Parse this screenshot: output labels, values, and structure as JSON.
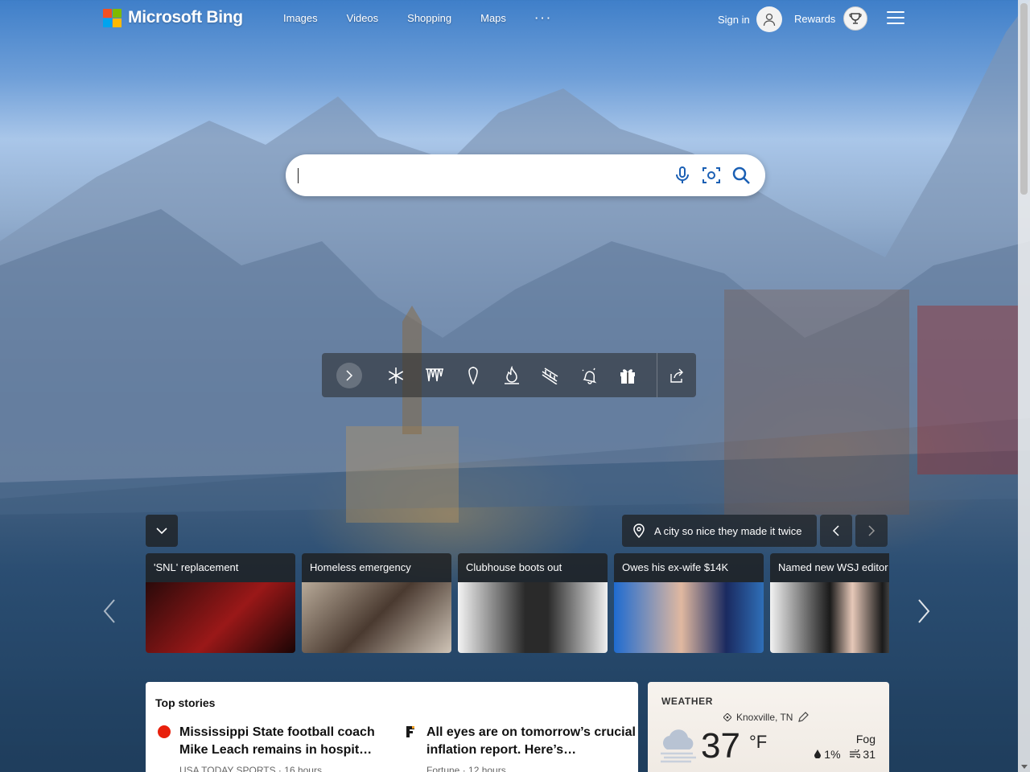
{
  "header": {
    "brand": "Microsoft Bing",
    "nav": [
      "Images",
      "Videos",
      "Shopping",
      "Maps",
      "···"
    ],
    "signin_label": "Sign in",
    "rewards_label": "Rewards"
  },
  "search": {
    "value": "",
    "placeholder": "",
    "icons": [
      "microphone-icon",
      "visual-search-icon",
      "search-icon"
    ]
  },
  "toolbar": {
    "icons": [
      "snowflake-icon",
      "icicles-icon",
      "carrot-icon",
      "fire-icon",
      "sled-icon",
      "bell-icon",
      "gift-icon",
      "share-icon"
    ]
  },
  "image_info": {
    "caption": "A city so nice they made it twice"
  },
  "news_cards": [
    {
      "caption": "'SNL' replacement",
      "pic_color": "#7a1010"
    },
    {
      "caption": "Homeless emergency",
      "pic_color": "#8a7a6a"
    },
    {
      "caption": "Clubhouse boots out",
      "pic_color": "#dcdcdc"
    },
    {
      "caption": "Owes his ex-wife $14K",
      "pic_color": "#2f6fb8"
    },
    {
      "caption": "Named new WSJ editor",
      "pic_color": "#e8e8e8"
    }
  ],
  "top_stories": {
    "title": "Top stories",
    "stories": [
      {
        "headline": "Mississippi State football coach Mike Leach remains in hospit…",
        "meta": "USA TODAY SPORTS · 16 hours",
        "source_color": "#e8200c"
      },
      {
        "headline": "All eyes are on tomorrow’s crucial inflation report. Here’s…",
        "meta": "Fortune · 12 hours",
        "source_color": "#1a1a1a"
      }
    ]
  },
  "weather": {
    "title": "WEATHER",
    "location": "Knoxville, TN",
    "temp": "37",
    "unit": "°F",
    "condition": "Fog",
    "precip": "1%",
    "wind": "31"
  },
  "colors": {
    "logo": [
      "#f25022",
      "#7fba00",
      "#00a4ef",
      "#ffb900"
    ]
  }
}
